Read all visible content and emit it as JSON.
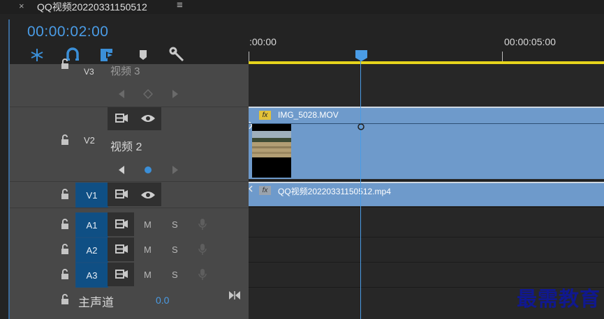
{
  "panel": {
    "close_glyph": "×",
    "title": "QQ视频20220331150512",
    "menu_glyph": "≡"
  },
  "timecode": "00:00:02:00",
  "toolbar": {
    "icons": [
      "snap-icon",
      "linked-selection-icon",
      "add-marker-icon",
      "marker-icon",
      "settings-wrench-icon"
    ]
  },
  "ruler": {
    "labels": [
      ":00:00",
      "00:00:05:00"
    ]
  },
  "tracks": {
    "v3": {
      "id": "V3",
      "name": "视频 3"
    },
    "v2": {
      "id": "V2",
      "name": "视频 2"
    },
    "v1": {
      "id": "V1"
    },
    "a1": {
      "id": "A1",
      "mute": "M",
      "solo": "S"
    },
    "a2": {
      "id": "A2",
      "mute": "M",
      "solo": "S"
    },
    "a3": {
      "id": "A3",
      "mute": "M",
      "solo": "S"
    },
    "master": {
      "name": "主声道",
      "value": "0.0"
    }
  },
  "clips": {
    "v2_clip": {
      "fx": "fx",
      "name": "IMG_5028.MOV"
    },
    "v1_clip": {
      "fx": "fx",
      "name": "QQ视频20220331150512.mp4"
    }
  },
  "colors": {
    "accent_blue": "#4a9ce6",
    "clip_blue": "#6e9acb",
    "work_area_yellow": "#e6d41c",
    "fx_badge_yellow": "#e2c23a",
    "watermark_navy": "#10188f"
  },
  "watermark": "最需教育"
}
